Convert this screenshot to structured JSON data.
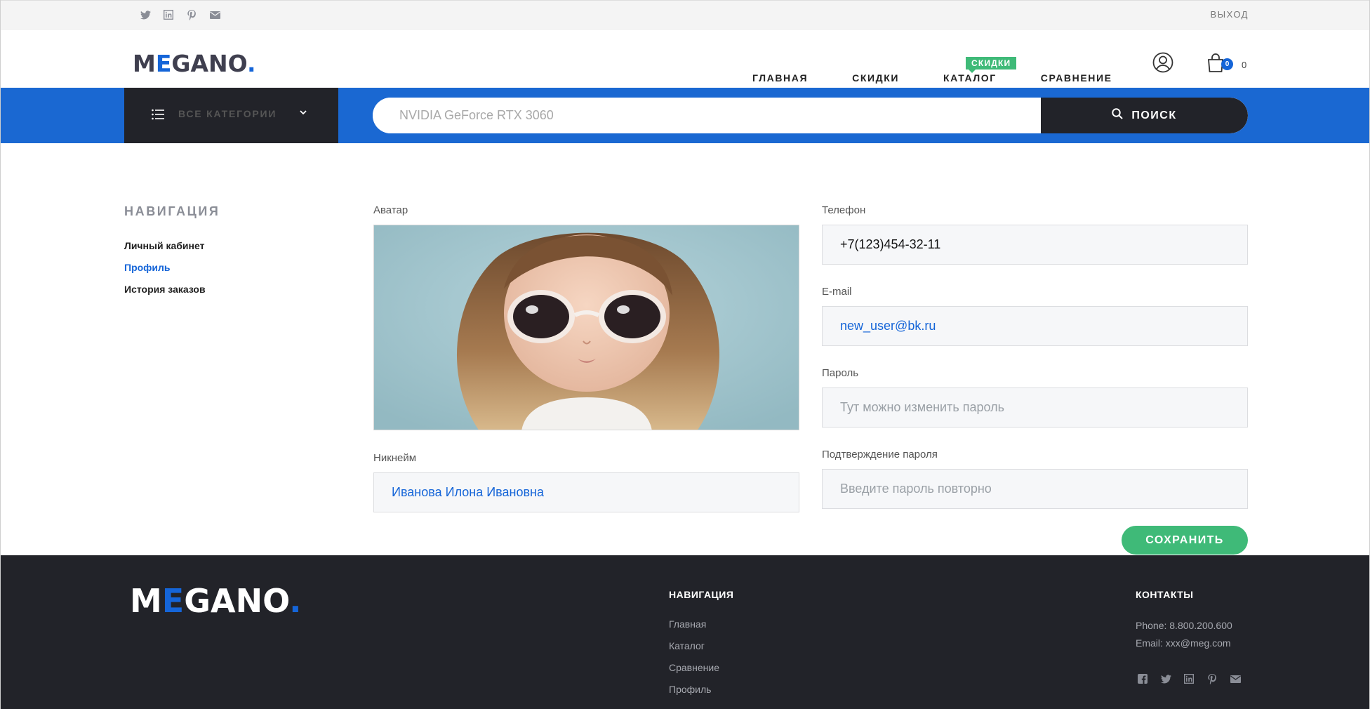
{
  "topbar": {
    "social_icons": [
      "twitter-icon",
      "linkedin-icon",
      "pinterest-icon",
      "mail-icon"
    ],
    "logout": "ВЫХОД"
  },
  "header": {
    "logo": {
      "prefix": "M",
      "accent": "E",
      "rest": "GANO",
      "dot": "."
    },
    "nav": [
      "ГЛАВНАЯ",
      "СКИДКИ",
      "КАТАЛОГ",
      "СРАВНЕНИЕ"
    ],
    "sale_badge": "СКИДКИ",
    "cart_count": "0",
    "cart_total": "0"
  },
  "searchbar": {
    "categories_label": "ВСЕ КАТЕГОРИИ",
    "placeholder": "NVIDIA GeForce RTX 3060",
    "search_label": "ПОИСК"
  },
  "sidebar": {
    "title": "НАВИГАЦИЯ",
    "items": [
      {
        "label": "Личный кабинет",
        "active": false
      },
      {
        "label": "Профиль",
        "active": true
      },
      {
        "label": "История заказов",
        "active": false
      }
    ]
  },
  "profile": {
    "avatar_label": "Аватар",
    "nickname_label": "Никнейм",
    "nickname_value": "Иванова Илона Ивановна",
    "phone_label": "Телефон",
    "phone_value": "+7(123)454-32-11",
    "email_label": "E-mail",
    "email_value": "new_user@bk.ru",
    "password_label": "Пароль",
    "password_placeholder": "Тут можно изменить пароль",
    "confirm_label": "Подтверждение пароля",
    "confirm_placeholder": "Введите пароль повторно",
    "save_label": "СОХРАНИТЬ"
  },
  "footer": {
    "logo": {
      "prefix": "M",
      "accent": "E",
      "rest": "GANO",
      "dot": "."
    },
    "nav_title": "НАВИГАЦИЯ",
    "nav_links": [
      "Главная",
      "Каталог",
      "Сравнение",
      "Профиль"
    ],
    "contacts_title": "КОНТАКТЫ",
    "phone": "Phone: 8.800.200.600",
    "email": "Email: xxx@meg.com",
    "social_icons": [
      "facebook-icon",
      "twitter-icon",
      "linkedin-icon",
      "pinterest-icon",
      "mail-icon"
    ]
  },
  "colors": {
    "accent": "#1565d8",
    "dark": "#222329",
    "green": "#3fba78"
  }
}
